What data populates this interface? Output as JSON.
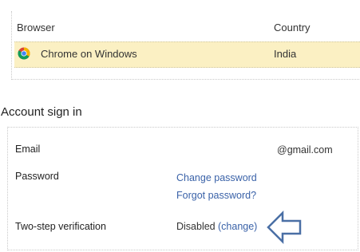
{
  "sessions": {
    "columns": {
      "browser": "Browser",
      "country": "Country"
    },
    "rows": [
      {
        "icon": "chrome-icon",
        "browser": "Chrome on Windows",
        "country": "India"
      }
    ]
  },
  "account": {
    "title": "Account sign in",
    "email": {
      "label": "Email",
      "value": "@gmail.com"
    },
    "password": {
      "label": "Password",
      "change_link": "Change password",
      "forgot_link": "Forgot password?"
    },
    "two_step": {
      "label": "Two-step verification",
      "status": "Disabled",
      "change_link": "(change)"
    }
  },
  "colors": {
    "highlight_row": "#fbf0c3",
    "link": "#3a62a8",
    "arrow": "#4a6fa5"
  }
}
